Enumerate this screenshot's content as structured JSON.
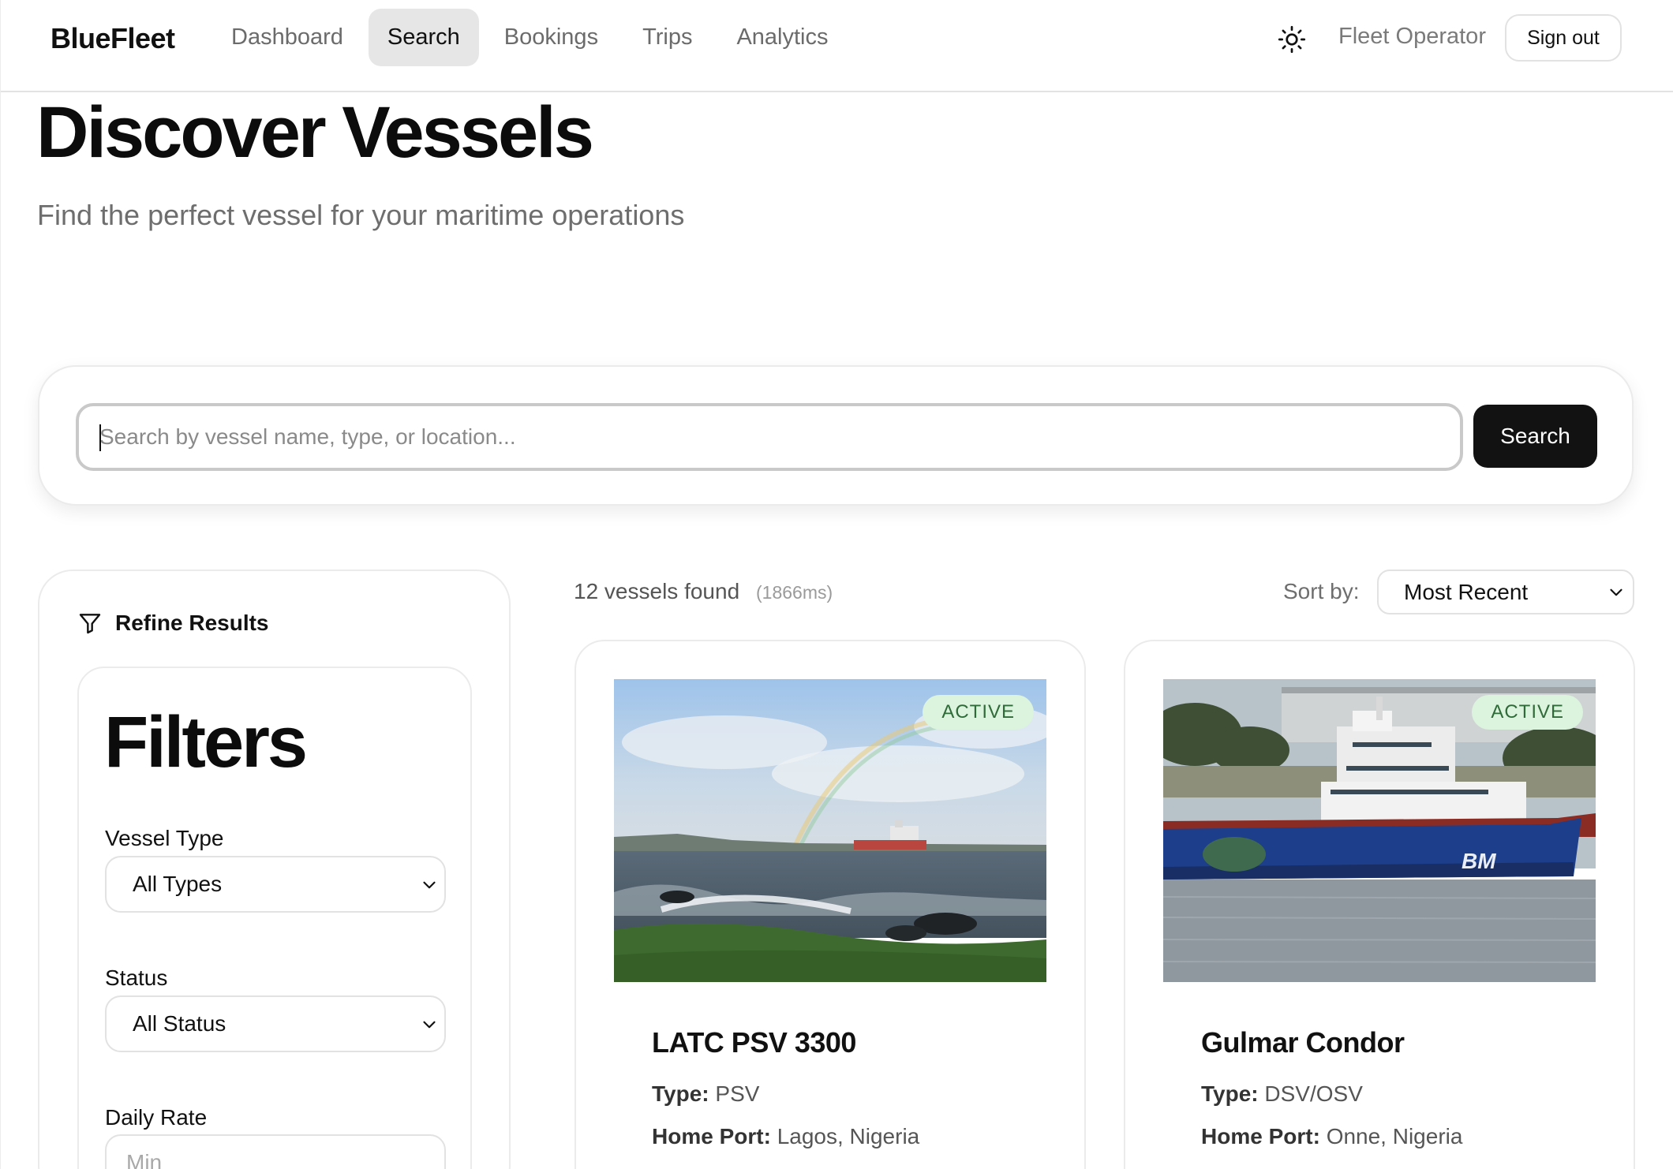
{
  "header": {
    "brand": "BlueFleet",
    "nav": [
      "Dashboard",
      "Search",
      "Bookings",
      "Trips",
      "Analytics"
    ],
    "active_nav": "Search",
    "user": "Fleet Operator",
    "sign_out": "Sign out",
    "theme_icon": "sun-icon"
  },
  "hero": {
    "title": "Discover Vessels",
    "subtitle": "Find the perfect vessel for your maritime operations"
  },
  "search": {
    "placeholder": "Search by vessel name, type, or location...",
    "value": "",
    "button": "Search"
  },
  "filters": {
    "refine_label": "Refine Results",
    "refine_icon": "filter-icon",
    "title": "Filters",
    "vessel_type_label": "Vessel Type",
    "vessel_type_value": "All Types",
    "status_label": "Status",
    "status_value": "All Status",
    "daily_rate_label": "Daily Rate",
    "min_placeholder": "Min"
  },
  "results": {
    "count": "12 vessels found",
    "time": "(1866ms)",
    "sort_label": "Sort by:",
    "sort_value": "Most Recent"
  },
  "vessels": [
    {
      "name": "LATC PSV 3300",
      "status": "ACTIVE",
      "type_label": "Type:",
      "type": "PSV",
      "port_label": "Home Port:",
      "port": "Lagos, Nigeria"
    },
    {
      "name": "Gulmar Condor",
      "status": "ACTIVE",
      "type_label": "Type:",
      "type": "DSV/OSV",
      "port_label": "Home Port:",
      "port": "Onne, Nigeria",
      "hull_text": "BM"
    }
  ],
  "colors": {
    "primary": "#121212",
    "active_badge_bg": "#dcf3de",
    "active_badge_text": "#2f6b38",
    "nav_active_bg": "#e6e6e6"
  }
}
